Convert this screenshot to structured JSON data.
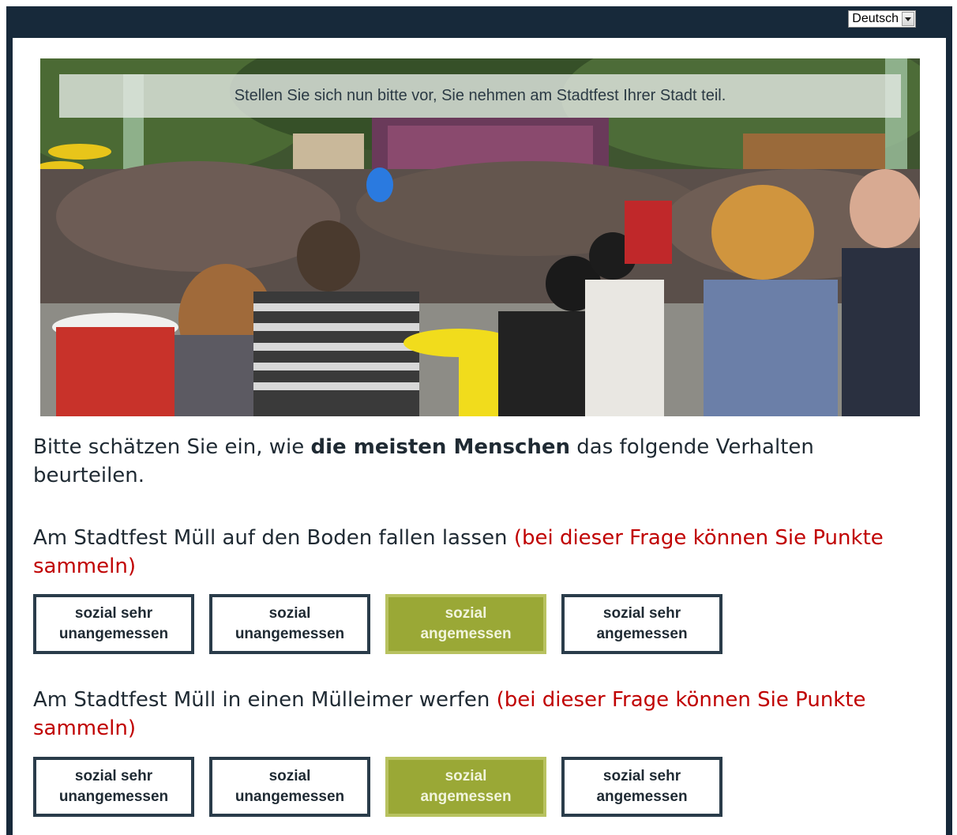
{
  "language_select": {
    "value": "Deutsch"
  },
  "hero": {
    "banner_text": "Stellen Sie sich nun bitte vor, Sie nehmen am Stadtfest Ihrer Stadt teil."
  },
  "instruction": {
    "prefix": "Bitte schätzen Sie ein, wie ",
    "bold": "die meisten Menschen",
    "suffix": " das folgende Verhalten beurteilen."
  },
  "questions": [
    {
      "text": "Am Stadtfest Müll auf den Boden fallen lassen ",
      "hint": "(bei dieser Frage können Sie Punkte sammeln)",
      "options": [
        {
          "label": "sozial sehr\nunangemessen",
          "selected": false
        },
        {
          "label": "sozial\nunangemessen",
          "selected": false
        },
        {
          "label": "sozial\nangemessen",
          "selected": true
        },
        {
          "label": "sozial sehr\nangemessen",
          "selected": false
        }
      ]
    },
    {
      "text": "Am Stadtfest Müll in einen Mülleimer werfen ",
      "hint": "(bei dieser Frage können Sie Punkte sammeln)",
      "options": [
        {
          "label": "sozial sehr\nunangemessen",
          "selected": false
        },
        {
          "label": "sozial\nunangemessen",
          "selected": false
        },
        {
          "label": "sozial\nangemessen",
          "selected": true
        },
        {
          "label": "sozial sehr\nangemessen",
          "selected": false
        }
      ]
    }
  ],
  "colors": {
    "frame": "#17293a",
    "selected_option": "#9aa836",
    "hint_red": "#c00000"
  }
}
